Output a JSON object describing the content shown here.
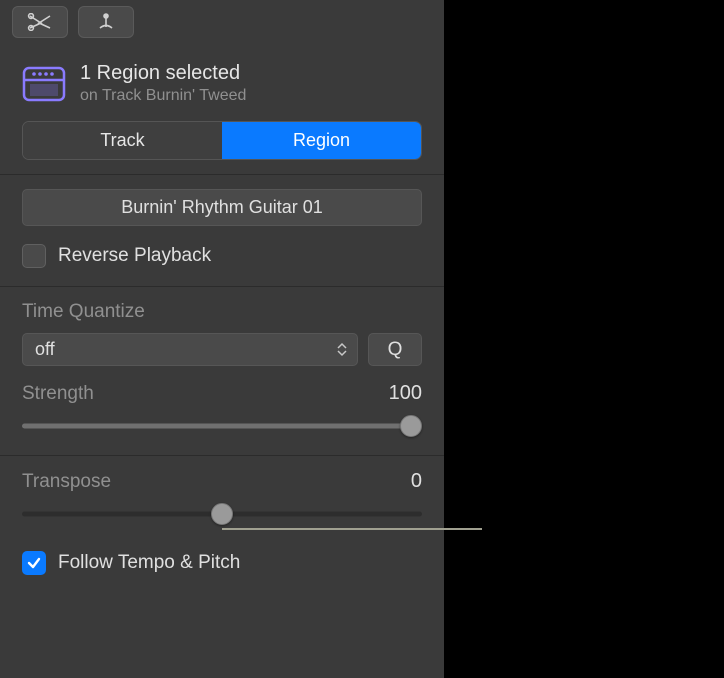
{
  "topbar": {
    "scissors_icon": "scissors",
    "tuning_fork_icon": "tuning-fork"
  },
  "header": {
    "title": "1 Region selected",
    "subtitle": "on Track Burnin' Tweed"
  },
  "segmented": {
    "track_label": "Track",
    "region_label": "Region"
  },
  "name_field": {
    "value": "Burnin' Rhythm Guitar 01"
  },
  "reverse": {
    "label": "Reverse Playback",
    "checked": false
  },
  "quantize": {
    "label": "Time Quantize",
    "dropdown_value": "off",
    "q_button": "Q",
    "strength_label": "Strength",
    "strength_value": "100",
    "strength_pct": 100
  },
  "transpose": {
    "label": "Transpose",
    "value": "0",
    "pct": 50
  },
  "follow": {
    "label": "Follow Tempo & Pitch",
    "checked": true
  }
}
